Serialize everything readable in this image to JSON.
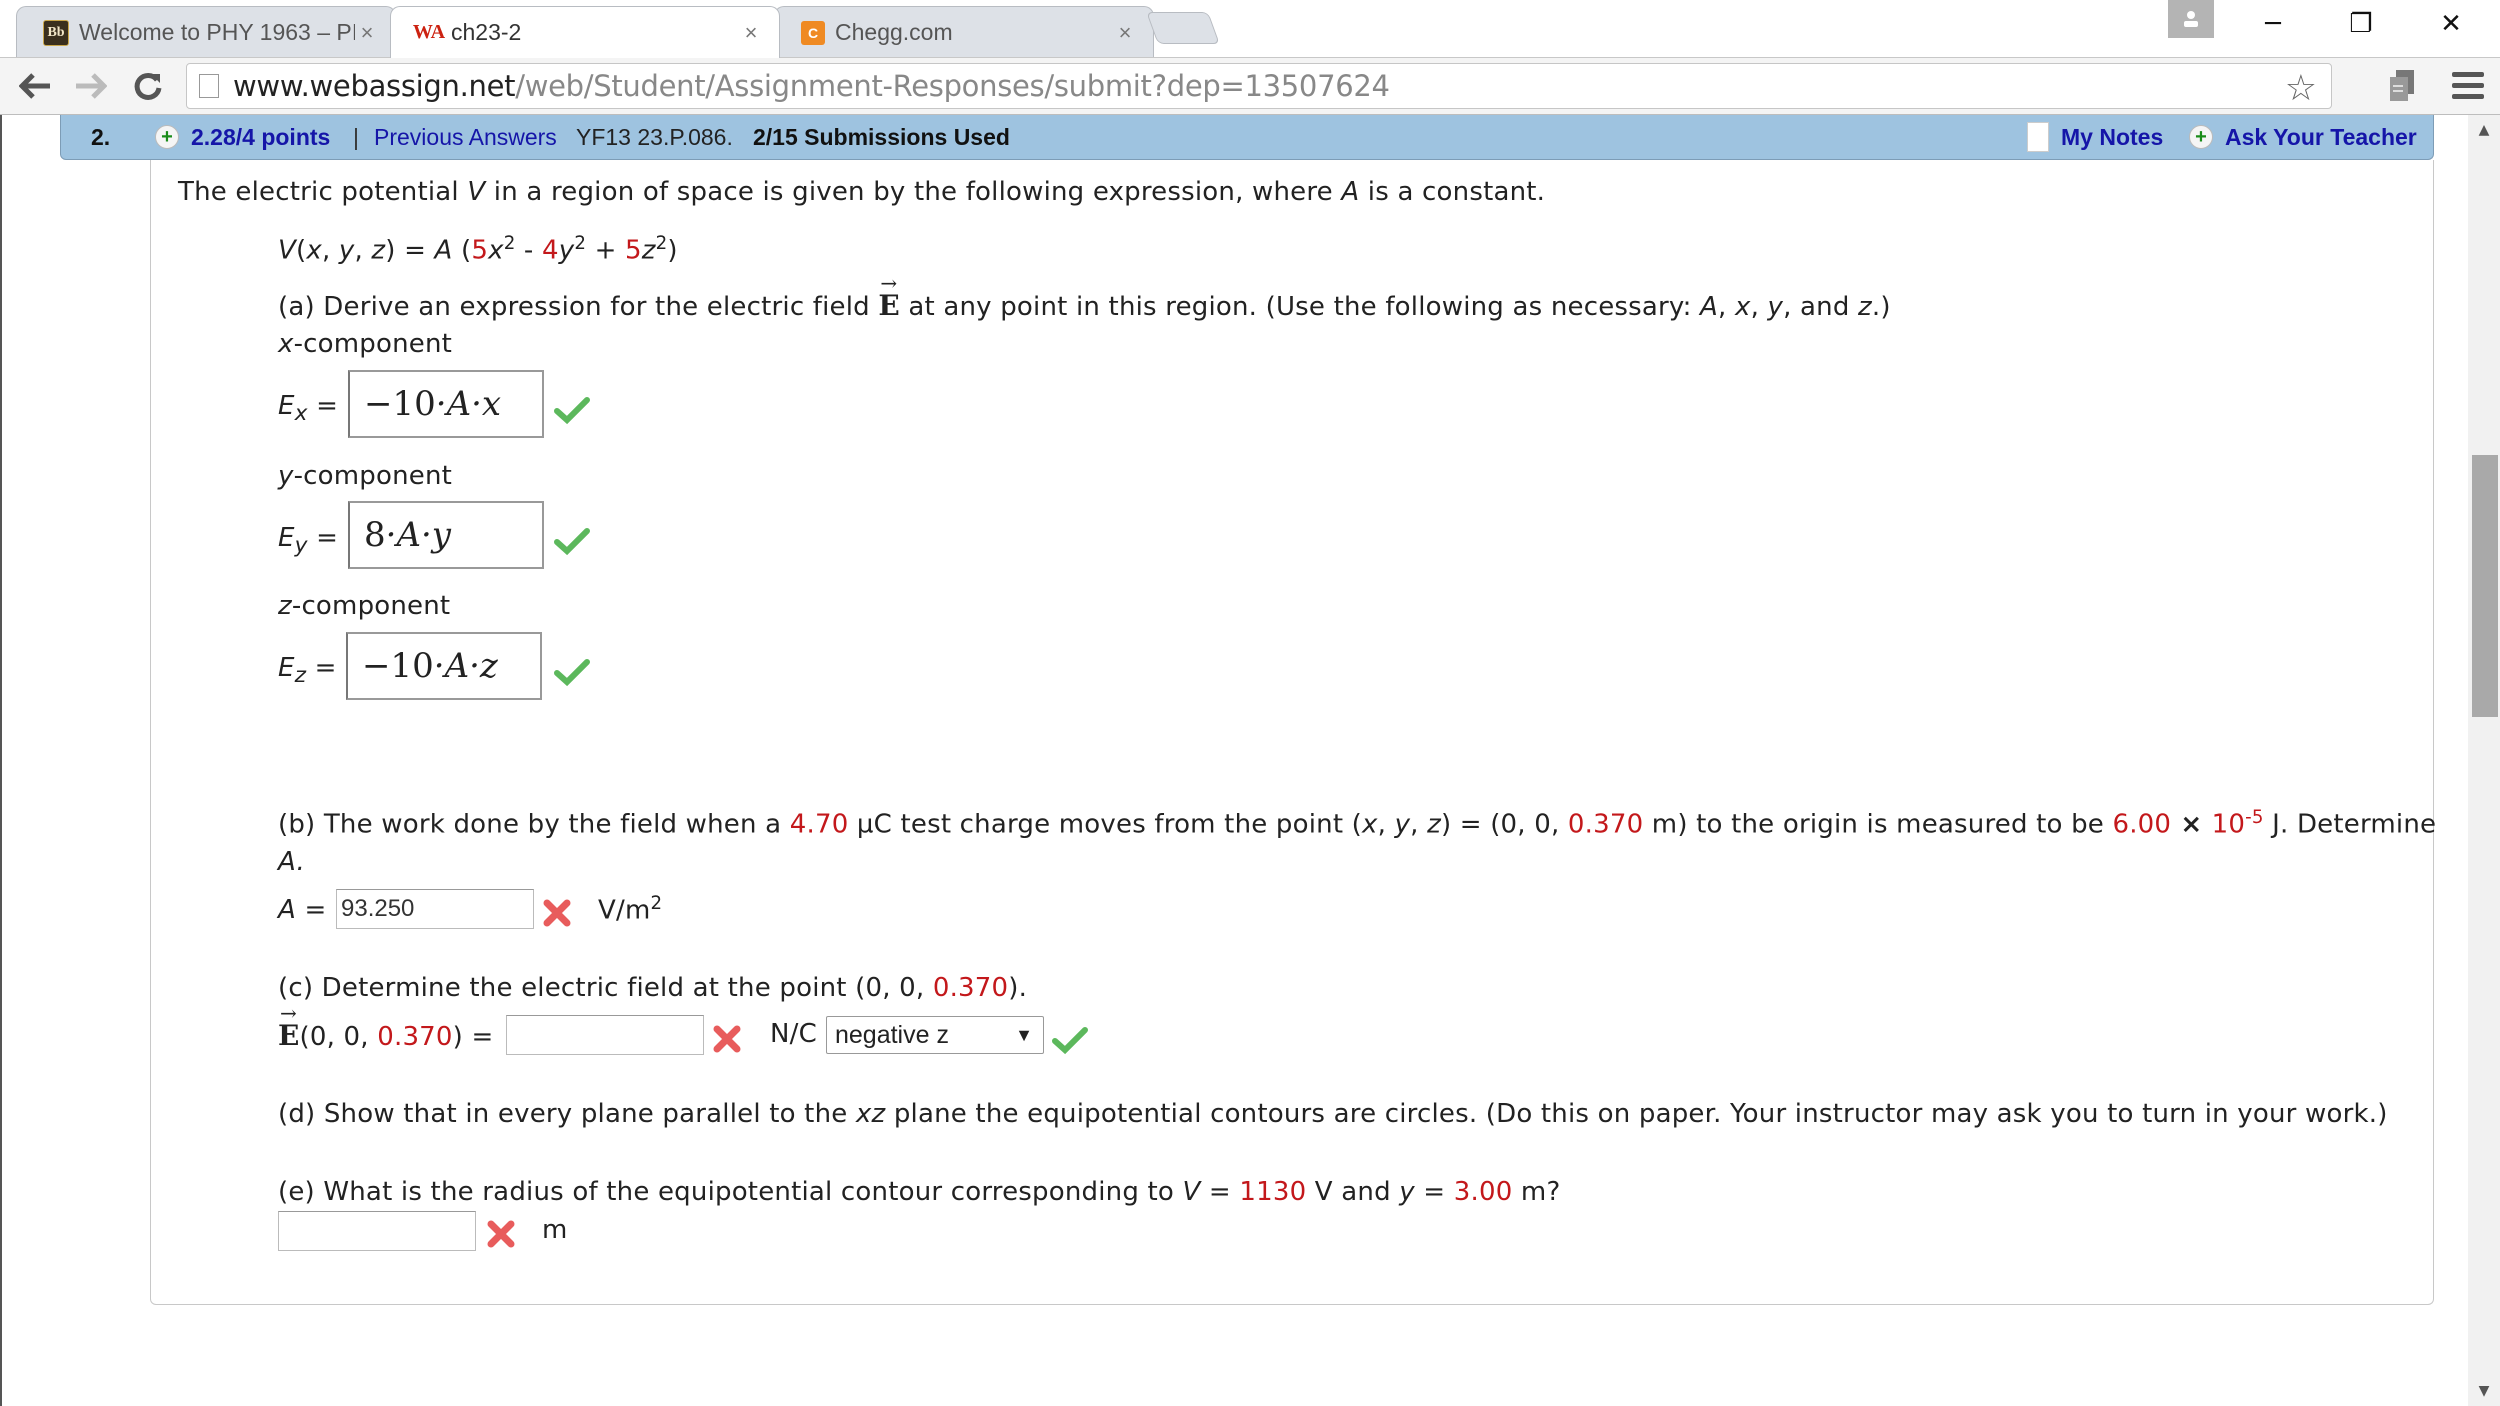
{
  "browser": {
    "tabs": [
      {
        "favicon": "Bb",
        "title": "Welcome to PHY 1963 – PI",
        "active": false
      },
      {
        "favicon": "WA",
        "title": "ch23-2",
        "active": true
      },
      {
        "favicon": "C",
        "title": "Chegg.com",
        "active": false
      }
    ],
    "close_glyph": "×",
    "url_host": "www.webassign.net",
    "url_path": "/web/Student/Assignment-Responses/submit?dep=13507624",
    "window": {
      "minimize": "─",
      "restore": "❐",
      "close": "✕"
    },
    "icons": {
      "back": "🡐",
      "forward": "🡒",
      "reload": "C",
      "star": "☆"
    }
  },
  "question": {
    "number": "2.",
    "points": "2.28/4 points",
    "separator": "|",
    "previous_answers": "Previous Answers",
    "code": "YF13 23.P.086.",
    "submissions": "2/15 Submissions Used",
    "my_notes": "My Notes",
    "ask_teacher": "Ask Your Teacher"
  },
  "problem": {
    "intro": [
      "The electric potential ",
      "V",
      " in a region of space is given by the following expression, where ",
      "A",
      " is a constant."
    ],
    "equation": {
      "lhs": "V(x, y, z) = A (",
      "c1": "5",
      "t1": "x",
      "c2": "4",
      "t2": "y",
      "c3": "5",
      "t3": "z",
      "exp": "2",
      "minus": " - ",
      "plus": " + ",
      "close": ")"
    },
    "part_a": {
      "prompt_pre": "(a) Derive an expression for the electric field ",
      "vector": "E",
      "prompt_post": " at any point in this region. (Use the following as necessary: ",
      "vars": [
        "A",
        "x",
        "y",
        "z"
      ],
      "components": [
        {
          "label_var": "x",
          "label_rest": "-component",
          "sym": "E",
          "sub": "x",
          "answer_num": "−10",
          "answer_rest": "·A·x",
          "status": "correct"
        },
        {
          "label_var": "y",
          "label_rest": "-component",
          "sym": "E",
          "sub": "y",
          "answer_num": "8",
          "answer_rest": "·A·y",
          "status": "correct"
        },
        {
          "label_var": "z",
          "label_rest": "-component",
          "sym": "E",
          "sub": "z",
          "answer_num": "−10",
          "answer_rest": "·A·z",
          "status": "correct"
        }
      ]
    },
    "part_b": {
      "t1": "(b) The work done by the field when a ",
      "charge": "4.70",
      "t2": " µC test charge moves from the point (",
      "t3": ") = (0, 0, ",
      "z": "0.370",
      "t4": " m) to the origin is measured to be ",
      "work_mant": "6.00",
      "times": " × ",
      "work_base": "10",
      "work_exp": "-5",
      "t5": " J. Determine",
      "t6": "A.",
      "label": "A =",
      "answer": "93.250",
      "status": "incorrect",
      "unit": "V/m",
      "unit_exp": "2"
    },
    "part_c": {
      "prompt_pre": "(c) Determine the electric field at the point (0, 0, ",
      "z": "0.370",
      "prompt_post": ").",
      "label_pre": "(0, 0, ",
      "label_post": ") =",
      "answer": "",
      "status": "incorrect",
      "unit": "N/C",
      "direction": "negative z",
      "direction_status": "correct"
    },
    "part_d": {
      "t1": "(d) Show that in every plane parallel to the ",
      "plane": "xz",
      "t2": " plane the equipotential contours are circles. (Do this on paper. Your instructor may ask you to turn in your work.)"
    },
    "part_e": {
      "t1": "(e) What is the radius of the equipotential contour corresponding to ",
      "V": "1130",
      "t2": " V and ",
      "y": "3.00",
      "t3": " m?",
      "answer": "",
      "status": "incorrect",
      "unit": "m"
    }
  },
  "colors": {
    "header_band": "#9ec3e0",
    "link_blue": "#1515a8",
    "value_red": "#c3181b",
    "correct_green": "#5cb85c",
    "incorrect_red": "#e85c5c"
  }
}
